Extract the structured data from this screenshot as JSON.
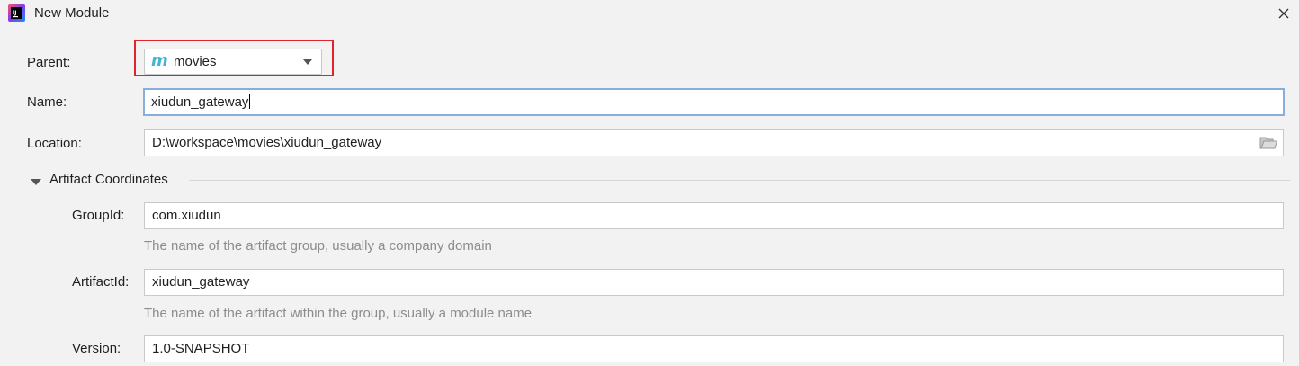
{
  "window": {
    "title": "New Module",
    "app_icon": "intellij-idea-icon",
    "close_icon": "close-icon"
  },
  "form": {
    "parent": {
      "label": "Parent:",
      "value": "movies",
      "module_icon": "m",
      "highlight_color": "#e0242c"
    },
    "name": {
      "label": "Name:",
      "value": "xiudun_gateway"
    },
    "location": {
      "label": "Location:",
      "value": "D:\\workspace\\movies\\xiudun_gateway",
      "browse_icon": "folder-icon"
    },
    "artifact_coordinates": {
      "title": "Artifact Coordinates",
      "expanded": true,
      "group_id": {
        "label": "GroupId:",
        "value": "com.xiudun",
        "hint": "The name of the artifact group, usually a company domain"
      },
      "artifact_id": {
        "label": "ArtifactId:",
        "value": "xiudun_gateway",
        "hint": "The name of the artifact within the group, usually a module name"
      },
      "version": {
        "label": "Version:",
        "value": "1.0-SNAPSHOT"
      }
    }
  }
}
